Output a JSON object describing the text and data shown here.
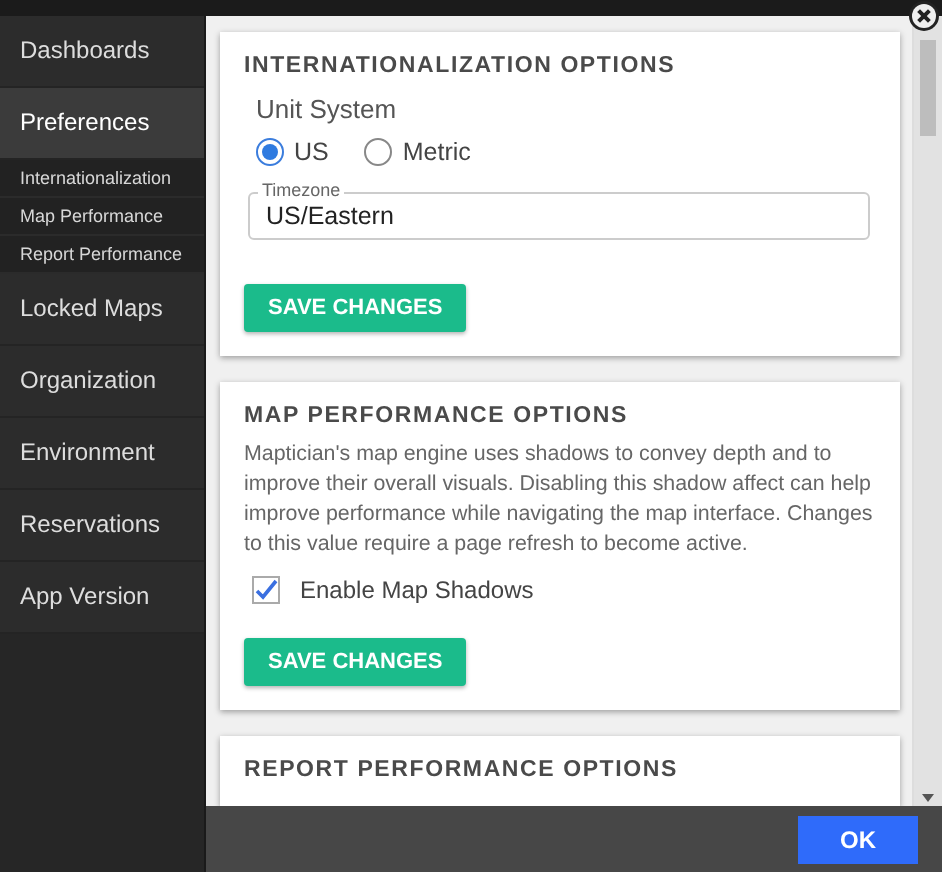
{
  "sidebar": {
    "items": [
      {
        "label": "Dashboards",
        "selected": false
      },
      {
        "label": "Preferences",
        "selected": true,
        "children": [
          {
            "label": "Internationalization",
            "selected": false
          },
          {
            "label": "Map Performance",
            "selected": false
          },
          {
            "label": "Report Performance",
            "selected": false
          }
        ]
      },
      {
        "label": "Locked Maps",
        "selected": false
      },
      {
        "label": "Organization",
        "selected": false
      },
      {
        "label": "Environment",
        "selected": false
      },
      {
        "label": "Reservations",
        "selected": false
      },
      {
        "label": "App Version",
        "selected": false
      }
    ]
  },
  "sections": [
    {
      "kind": "units",
      "title": "INTERNATIONALIZATION OPTIONS",
      "unit_label": "Unit System",
      "options": [
        {
          "label": "US",
          "selected": true
        },
        {
          "label": "Metric",
          "selected": false
        }
      ],
      "timezone": {
        "label": "Timezone",
        "value": "US/Eastern"
      },
      "button": "SAVE CHANGES"
    },
    {
      "kind": "toggle",
      "title": "MAP PERFORMANCE OPTIONS",
      "description": "Maptician's map engine uses shadows to convey depth and to improve their overall visuals. Disabling this shadow affect can help improve performance while navigating the map interface. Changes to this value require a page refresh to become active.",
      "checkbox": {
        "label": "Enable Map Shadows",
        "checked": true
      },
      "button": "SAVE CHANGES"
    },
    {
      "kind": "header",
      "title": "REPORT PERFORMANCE OPTIONS"
    }
  ],
  "footer": {
    "button": "OK"
  }
}
